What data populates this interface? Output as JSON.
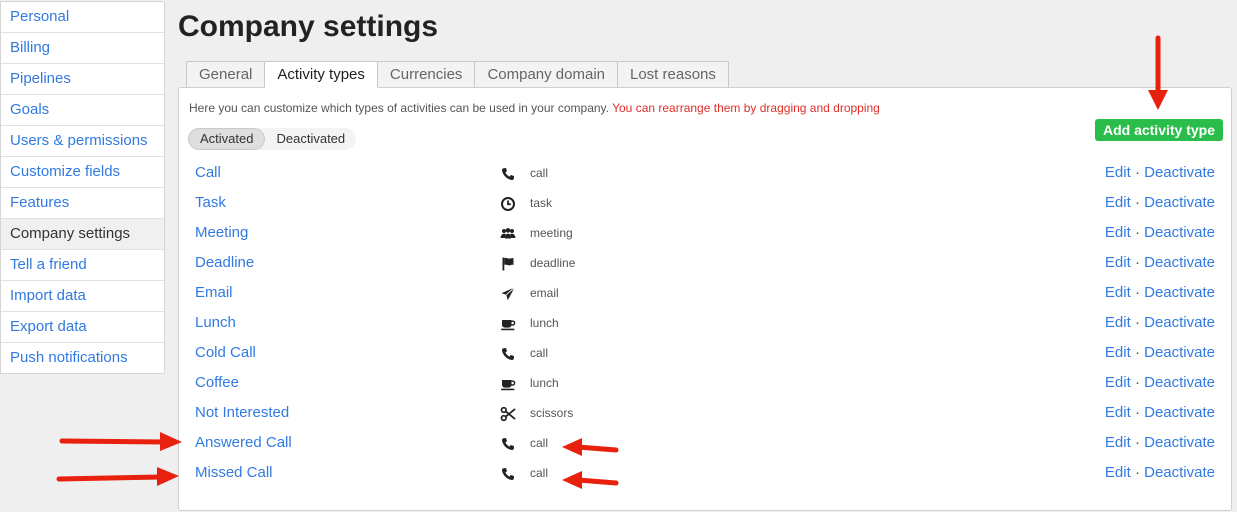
{
  "sidebar": {
    "items": [
      {
        "label": "Personal"
      },
      {
        "label": "Billing"
      },
      {
        "label": "Pipelines"
      },
      {
        "label": "Goals"
      },
      {
        "label": "Users & permissions"
      },
      {
        "label": "Customize fields"
      },
      {
        "label": "Features"
      },
      {
        "label": "Company settings"
      },
      {
        "label": "Tell a friend"
      },
      {
        "label": "Import data"
      },
      {
        "label": "Export data"
      },
      {
        "label": "Push notifications"
      }
    ],
    "active_index": 7
  },
  "page": {
    "title": "Company settings"
  },
  "tabs": [
    {
      "label": "General"
    },
    {
      "label": "Activity types"
    },
    {
      "label": "Currencies"
    },
    {
      "label": "Company domain"
    },
    {
      "label": "Lost reasons"
    }
  ],
  "panel": {
    "intro": "Here you can customize which types of activities can be used in your company.",
    "hint": "You can rearrange them by dragging and dropping",
    "add_button": "Add activity type",
    "toggle": {
      "activated": "Activated",
      "deactivated": "Deactivated"
    },
    "edit_label": "Edit",
    "separator": "·",
    "deactivate_label": "Deactivate"
  },
  "activity_types": [
    {
      "name": "Call",
      "icon": "phone-icon",
      "key": "call"
    },
    {
      "name": "Task",
      "icon": "clock-icon",
      "key": "task"
    },
    {
      "name": "Meeting",
      "icon": "people-icon",
      "key": "meeting"
    },
    {
      "name": "Deadline",
      "icon": "flag-icon",
      "key": "deadline"
    },
    {
      "name": "Email",
      "icon": "paper-plane-icon",
      "key": "email"
    },
    {
      "name": "Lunch",
      "icon": "cup-icon",
      "key": "lunch"
    },
    {
      "name": "Cold Call",
      "icon": "phone-icon",
      "key": "call"
    },
    {
      "name": "Coffee",
      "icon": "cup-icon",
      "key": "lunch"
    },
    {
      "name": "Not Interested",
      "icon": "scissors-icon",
      "key": "scissors"
    },
    {
      "name": "Answered Call",
      "icon": "phone-icon",
      "key": "call"
    },
    {
      "name": "Missed Call",
      "icon": "phone-icon",
      "key": "call"
    }
  ],
  "colors": {
    "accent": "#317ae2",
    "add_button": "#2bbd4b",
    "hint": "#e0302a",
    "annotation_arrow": "#e8200e"
  }
}
